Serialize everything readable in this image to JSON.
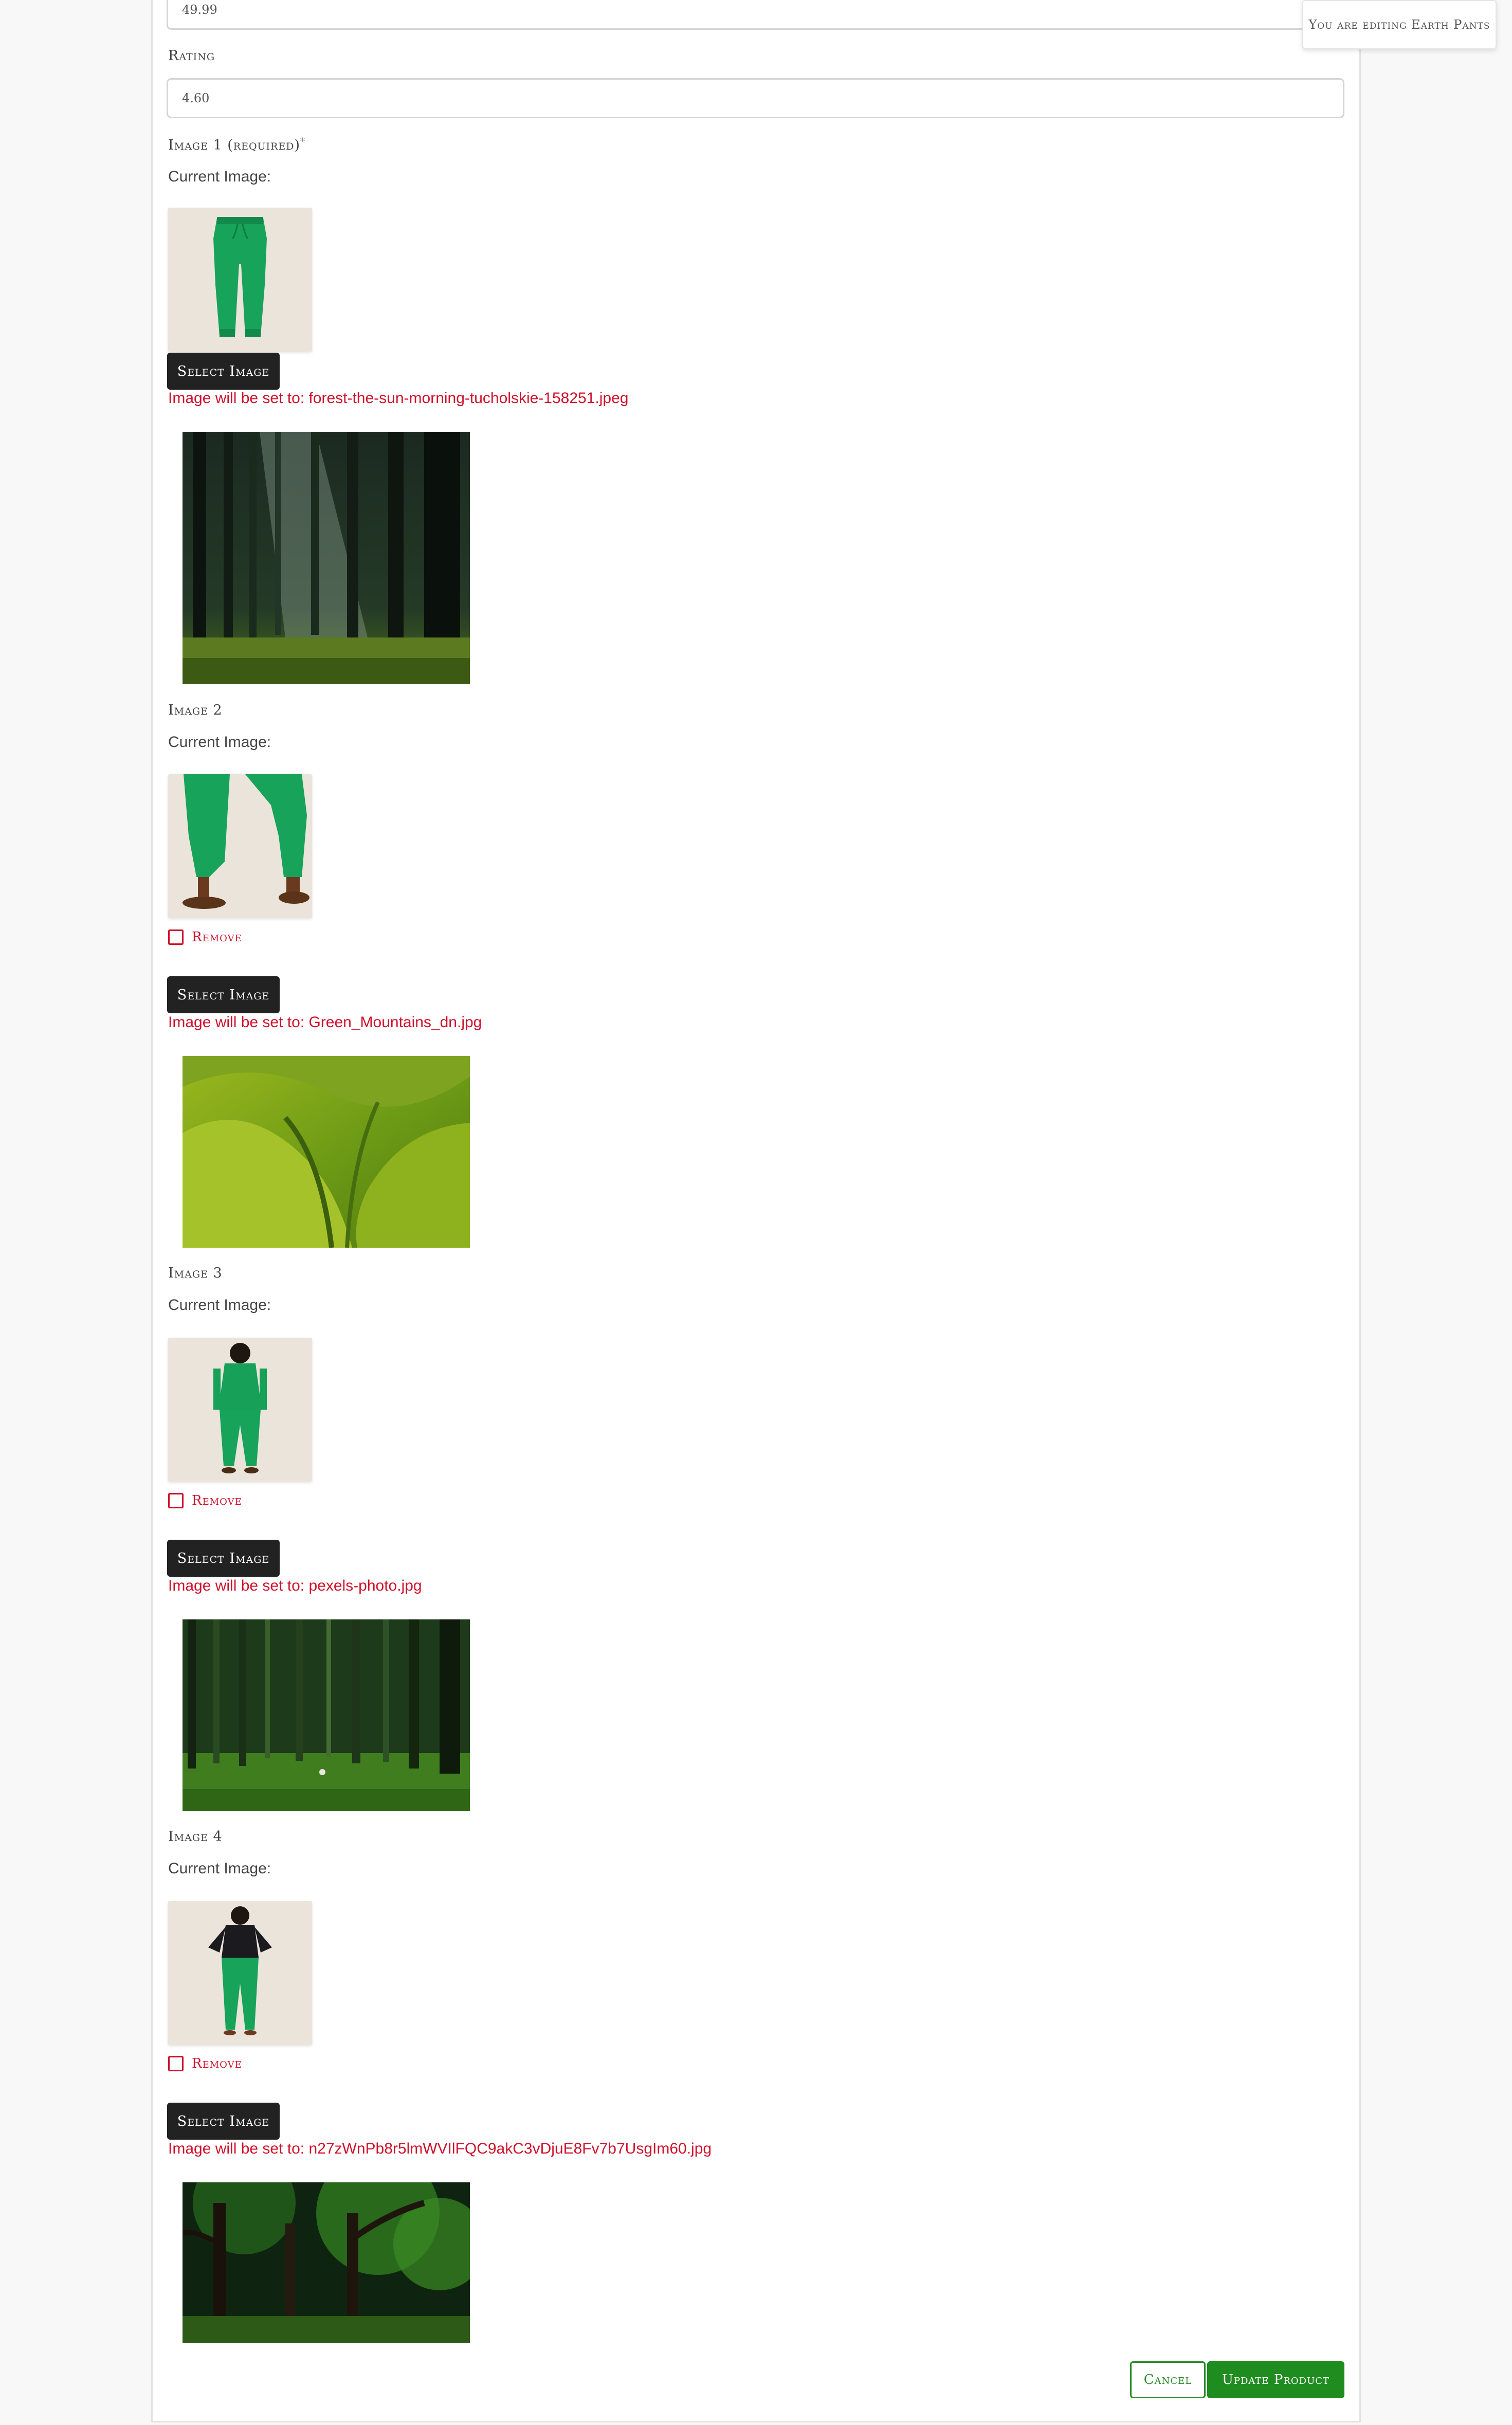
{
  "price": {
    "value": "49.99"
  },
  "toast": {
    "text": "You are editing Earth Pants"
  },
  "rating": {
    "label": "Rating",
    "value": "4.60"
  },
  "images": [
    {
      "label": "Image 1 (required)",
      "required_mark": "*",
      "current_label": "Current Image:",
      "thumb_icon": "green-pants-flat-image",
      "select_label": "Select Image",
      "notice": "Image will be set to: forest-the-sun-morning-tucholskie-158251.jpeg",
      "preview_icon": "sunlit-forest-image"
    },
    {
      "label": "Image 2",
      "current_label": "Current Image:",
      "thumb_icon": "green-pants-legs-image",
      "remove_label": "Remove",
      "select_label": "Select Image",
      "notice": "Image will be set to: Green_Mountains_dn.jpg",
      "preview_icon": "green-mountains-image"
    },
    {
      "label": "Image 3",
      "current_label": "Current Image:",
      "thumb_icon": "model-green-tracksuit-back-image",
      "remove_label": "Remove",
      "select_label": "Select Image",
      "notice": "Image will be set to: pexels-photo.jpg",
      "preview_icon": "pine-forest-image"
    },
    {
      "label": "Image 4",
      "current_label": "Current Image:",
      "thumb_icon": "model-green-pants-front-image",
      "remove_label": "Remove",
      "select_label": "Select Image",
      "notice": "Image will be set to: n27zWnPb8r5lmWVIlFQC9akC3vDjuE8Fv7b7UsgIm60.jpg",
      "preview_icon": "jungle-forest-image"
    }
  ],
  "actions": {
    "cancel_label": "Cancel",
    "update_label": "Update Product"
  },
  "colors": {
    "accent_green": "#1e8c1e",
    "notice_red": "#d0112b",
    "button_dark": "#222222"
  }
}
